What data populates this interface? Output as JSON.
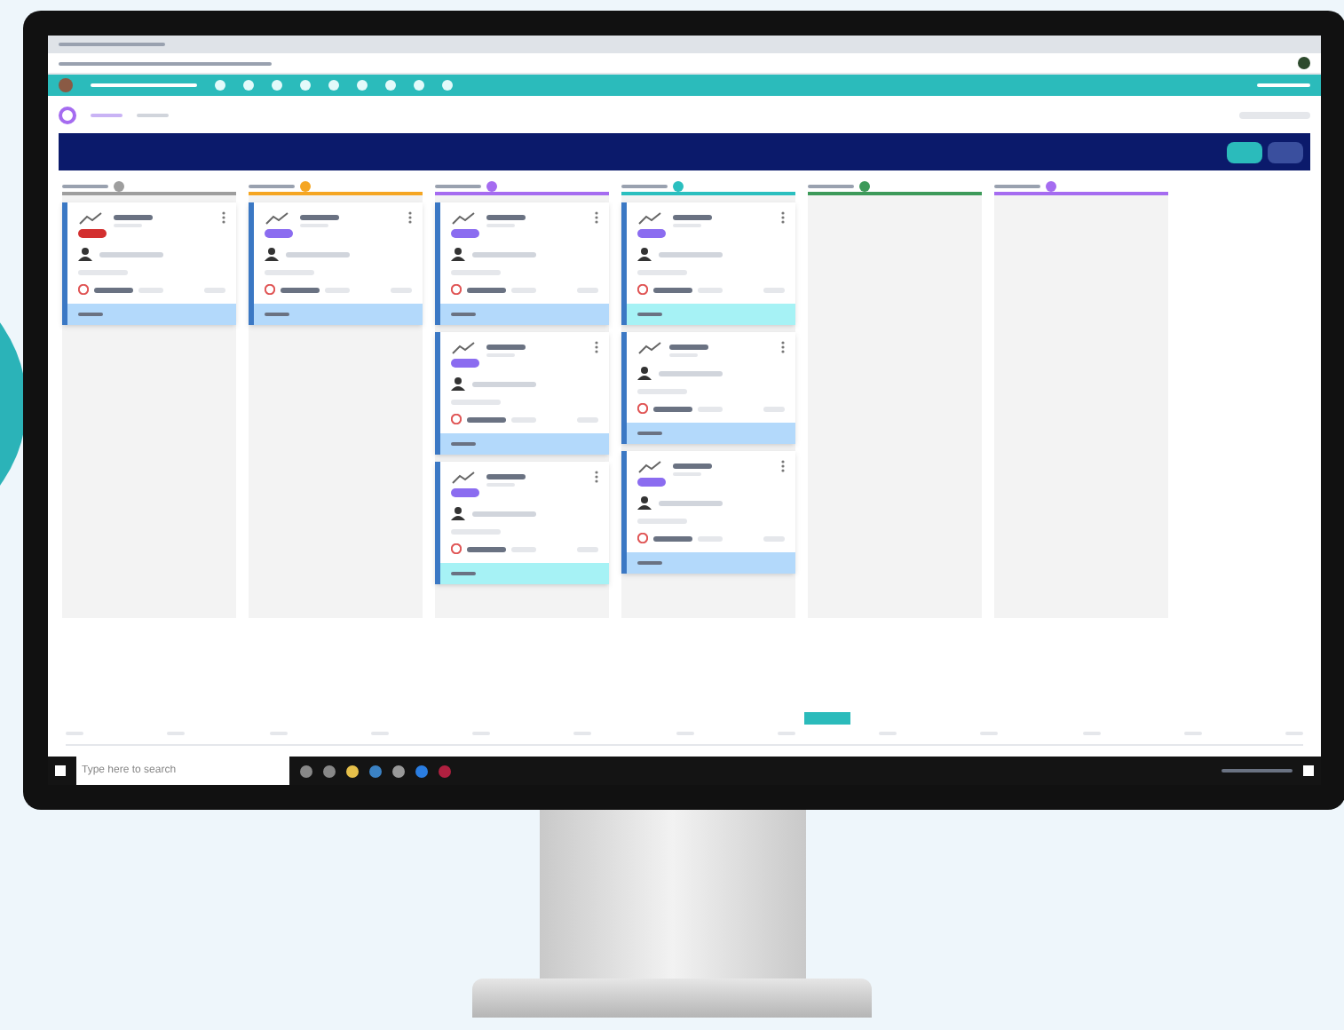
{
  "board": {
    "columns": [
      {
        "color": "#9e9e9e",
        "cards": [
          {
            "tag": {
              "color": "#d32f2f"
            },
            "footer": {
              "color": "#b3d9fb"
            }
          }
        ]
      },
      {
        "color": "#f5a623",
        "cards": [
          {
            "tag": {
              "color": "#8b6cf0"
            },
            "footer": {
              "color": "#b3d9fb"
            }
          }
        ]
      },
      {
        "color": "#a56cf0",
        "cards": [
          {
            "tag": {
              "color": "#8b6cf0"
            },
            "footer": {
              "color": "#b3d9fb"
            }
          },
          {
            "tag": {
              "color": "#8b6cf0"
            },
            "footer": {
              "color": "#b3d9fb"
            }
          },
          {
            "tag": {
              "color": "#8b6cf0"
            },
            "footer": {
              "color": "#a6f2f5"
            }
          }
        ]
      },
      {
        "color": "#2bbfbf",
        "cards": [
          {
            "tag": {
              "color": "#8b6cf0"
            },
            "footer": {
              "color": "#a6f2f5"
            }
          },
          {
            "footer": {
              "color": "#b3d9fb"
            }
          },
          {
            "tag": {
              "color": "#8b6cf0"
            },
            "footer": {
              "color": "#b3d9fb"
            }
          }
        ]
      },
      {
        "color": "#3d9a5a"
      },
      {
        "color": "#a56cf0"
      }
    ]
  },
  "taskbar": {
    "search": {
      "placeholder": "Type here to search"
    }
  }
}
